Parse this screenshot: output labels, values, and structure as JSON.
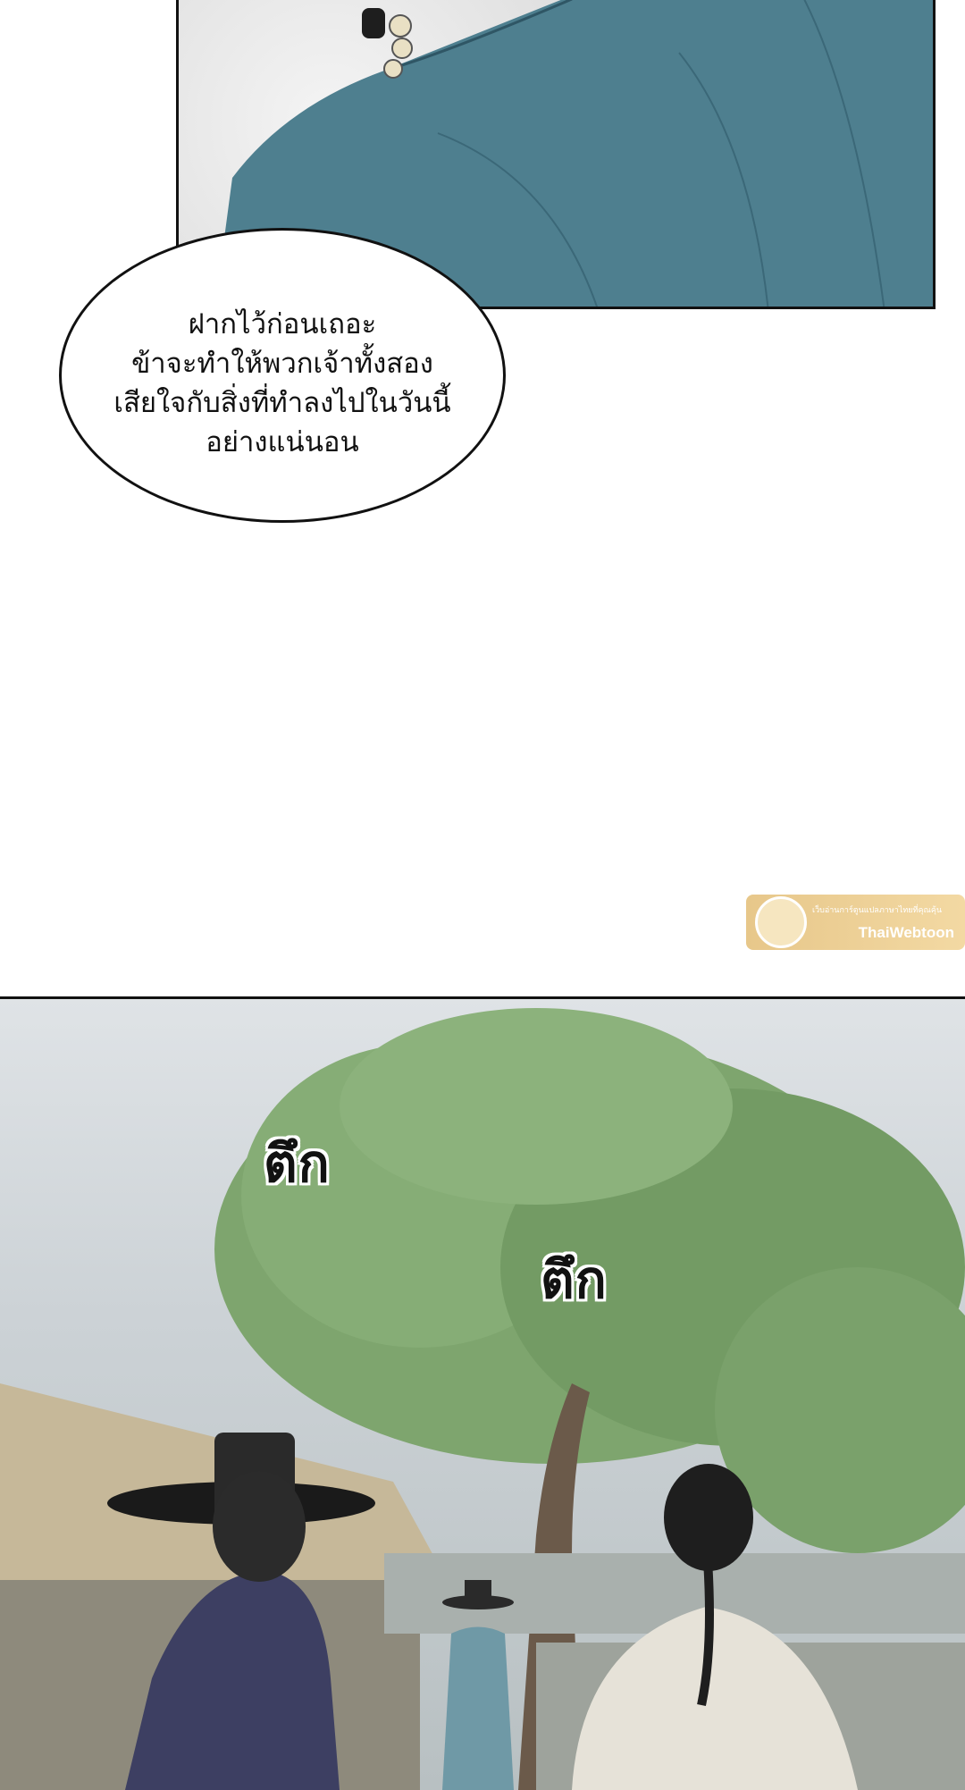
{
  "speech_bubble": {
    "text": "ฝากไว้ก่อนเถอะ\nข้าจะทำให้พวกเจ้าทั้งสอง\nเสียใจกับสิ่งที่ทำลงไปในวันนี้\nอย่างแน่นอน"
  },
  "sound_effects": [
    {
      "text": "ตึก"
    },
    {
      "text": "ตึก"
    }
  ],
  "watermark": {
    "brand": "ThaiWebtoon",
    "tagline": "เว็บอ่านการ์ตูนแปลภาษาไทยที่คุณคุ้น",
    "logo_label": "Thai Webtoon"
  },
  "colors": {
    "robe_teal": "#4e7f8f",
    "tree_green": "#6f9a5f",
    "sky": "#dfe3e6",
    "dark_robe": "#3d3f62",
    "white_robe": "#e6e2d8"
  }
}
